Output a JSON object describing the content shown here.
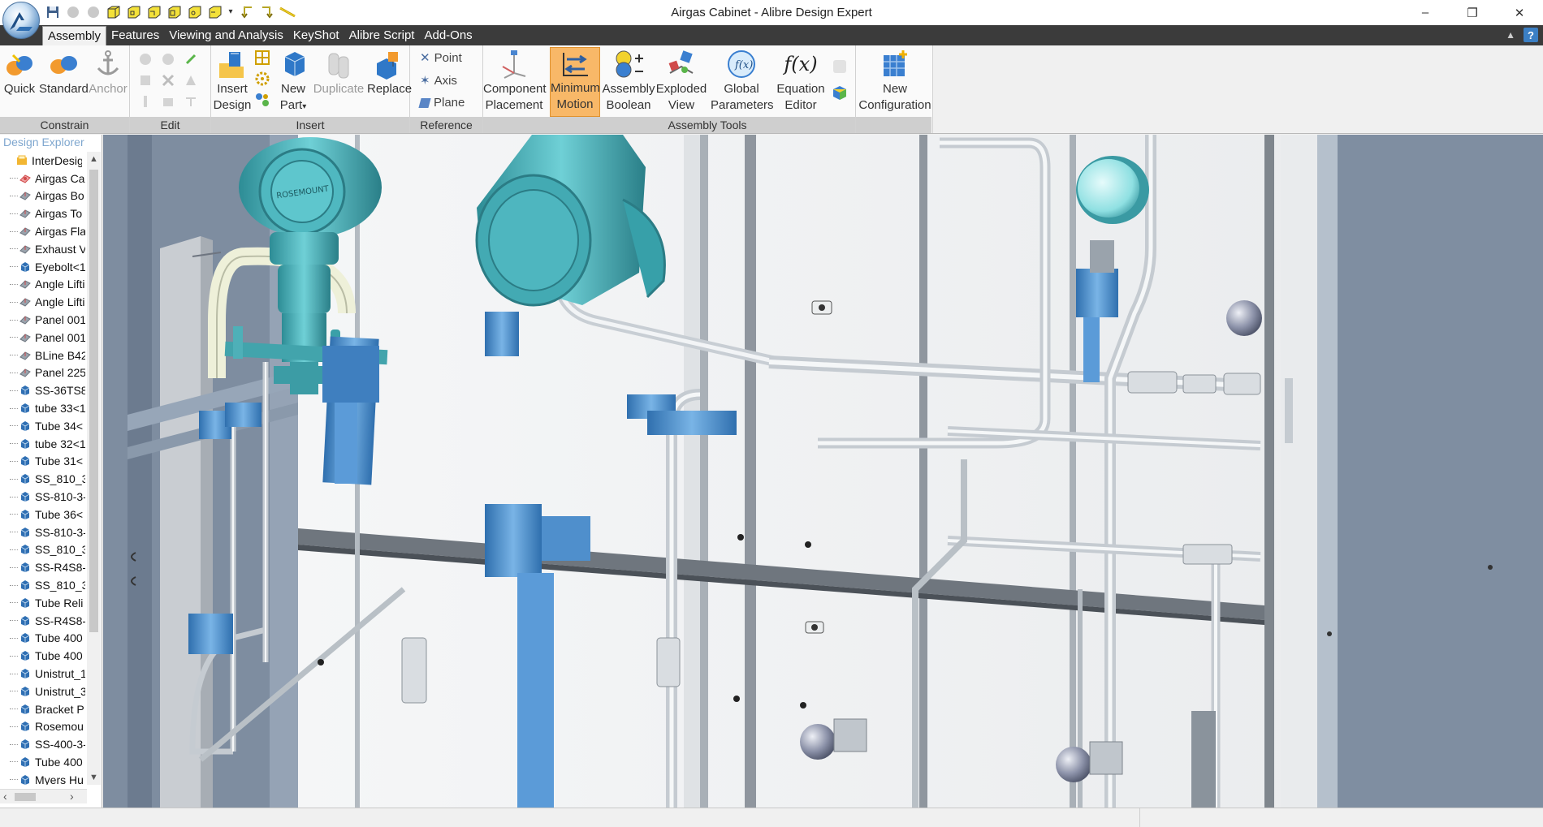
{
  "window": {
    "title": "Airgas Cabinet - Alibre Design Expert",
    "minimize": "–",
    "restore": "❐",
    "close": "✕"
  },
  "qat": {
    "icons": [
      "save-icon",
      "undo-icon",
      "redo-icon",
      "new-part-icon",
      "new-assembly-icon",
      "new-sheetmetal-icon",
      "new-drawing-icon",
      "new-design-icon",
      "open-icon",
      "dropdown-icon",
      "arrow-left-icon",
      "arrow-right-icon",
      "measure-icon"
    ]
  },
  "ribbon_tabs": [
    "Assembly",
    "Features",
    "Viewing and Analysis",
    "KeyShot",
    "Alibre Script",
    "Add-Ons"
  ],
  "active_tab": "Assembly",
  "ribbon": {
    "constrain": {
      "label": "Constrain",
      "quick": "Quick",
      "standard": "Standard",
      "anchor": "Anchor"
    },
    "edit": {
      "label": "Edit"
    },
    "insert": {
      "label": "Insert",
      "insert_design_1": "Insert",
      "insert_design_2": "Design",
      "new_part_1": "New",
      "new_part_2": "Part",
      "duplicate": "Duplicate",
      "replace": "Replace"
    },
    "reference": {
      "label": "Reference",
      "point": "Point",
      "axis": "Axis",
      "plane": "Plane"
    },
    "assembly_tools": {
      "label": "Assembly Tools",
      "component_placement_1": "Component",
      "component_placement_2": "Placement",
      "minimum_motion_1": "Minimum",
      "minimum_motion_2": "Motion",
      "assembly_boolean_1": "Assembly",
      "assembly_boolean_2": "Boolean",
      "exploded_view_1": "Exploded",
      "exploded_view_2": "View",
      "global_parameters_1": "Global",
      "global_parameters_2": "Parameters",
      "equation_editor_1": "Equation",
      "equation_editor_2": "Editor",
      "fx_glyph": "f(x)",
      "new_configuration_1": "New",
      "new_configuration_2": "Configuration"
    },
    "colors": {
      "selected_bg": "#f8b868",
      "tab_bar": "#3b3b3b",
      "group_label_bg": "#cfcfcf"
    }
  },
  "design_explorer": {
    "title": "Design Explorer",
    "items": [
      {
        "label": "InterDesig",
        "icon": "root-assembly-icon"
      },
      {
        "label": "Airgas Ca",
        "icon": "assembly-icon"
      },
      {
        "label": "Airgas Bo",
        "icon": "sheetmetal-icon"
      },
      {
        "label": "Airgas To",
        "icon": "sheetmetal-icon"
      },
      {
        "label": "Airgas Fla",
        "icon": "sheetmetal-icon"
      },
      {
        "label": "Exhaust V",
        "icon": "sheetmetal-icon"
      },
      {
        "label": "Eyebolt<1",
        "icon": "part-icon"
      },
      {
        "label": "Angle Lifti",
        "icon": "sheetmetal-icon"
      },
      {
        "label": "Angle Lifti",
        "icon": "sheetmetal-icon"
      },
      {
        "label": "Panel 001",
        "icon": "sheetmetal-icon"
      },
      {
        "label": "Panel 001",
        "icon": "sheetmetal-icon"
      },
      {
        "label": "BLine B42",
        "icon": "sheetmetal-icon"
      },
      {
        "label": "Panel 225",
        "icon": "sheetmetal-icon"
      },
      {
        "label": "SS-36TS8",
        "icon": "part-icon"
      },
      {
        "label": "tube 33<1",
        "icon": "part-icon"
      },
      {
        "label": "Tube 34<",
        "icon": "part-icon"
      },
      {
        "label": "tube 32<1",
        "icon": "part-icon"
      },
      {
        "label": "Tube 31<",
        "icon": "part-icon"
      },
      {
        "label": "SS_810_3",
        "icon": "part-icon"
      },
      {
        "label": "SS-810-3-",
        "icon": "part-icon"
      },
      {
        "label": "Tube 36<",
        "icon": "part-icon"
      },
      {
        "label": "SS-810-3-",
        "icon": "part-icon"
      },
      {
        "label": "SS_810_3",
        "icon": "part-icon"
      },
      {
        "label": "SS-R4S8-",
        "icon": "part-icon"
      },
      {
        "label": "SS_810_3",
        "icon": "part-icon"
      },
      {
        "label": "Tube Reli",
        "icon": "part-icon"
      },
      {
        "label": "SS-R4S8-",
        "icon": "part-icon"
      },
      {
        "label": "Tube 400",
        "icon": "part-icon"
      },
      {
        "label": "Tube 400",
        "icon": "part-icon"
      },
      {
        "label": "Unistrut_1",
        "icon": "part-icon"
      },
      {
        "label": "Unistrut_3",
        "icon": "part-icon"
      },
      {
        "label": "Bracket P",
        "icon": "part-icon"
      },
      {
        "label": "Rosemou",
        "icon": "part-icon"
      },
      {
        "label": "SS-400-3-",
        "icon": "part-icon"
      },
      {
        "label": "Tube 400",
        "icon": "part-icon"
      },
      {
        "label": "Myers Hu",
        "icon": "part-icon"
      }
    ]
  },
  "viewport": {
    "model_label_1": "ROSEMOUNT"
  }
}
